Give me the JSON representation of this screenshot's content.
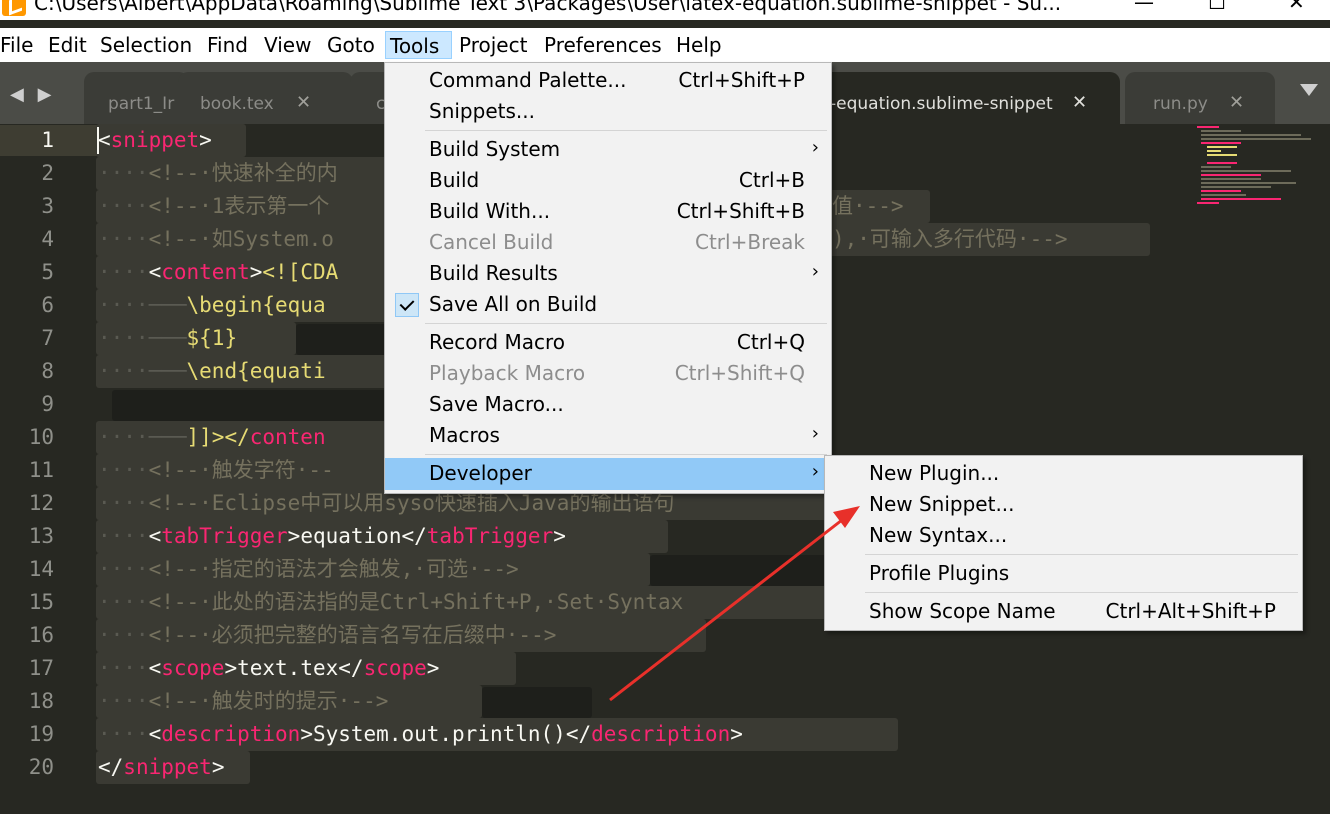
{
  "titlebar": {
    "title": "C:\\Users\\Albert\\AppData\\Roaming\\Sublime Text 3\\Packages\\User\\latex-equation.sublime-snippet - Su...",
    "minimize": "—",
    "maximize": "☐",
    "close": "✕"
  },
  "menubar": {
    "file": "File",
    "edit": "Edit",
    "selection": "Selection",
    "find": "Find",
    "view": "View",
    "goto": "Goto",
    "tools": "Tools",
    "project": "Project",
    "preferences": "Preferences",
    "help": "Help"
  },
  "tabs": {
    "nav_arrows": "◀ ▶",
    "t1": "part1_Ir",
    "t2": "book.tex",
    "t3": "c",
    "t4": "-equation.sublime-snippet",
    "t5": "run.py",
    "close": "✕"
  },
  "gutter": [
    "1",
    "2",
    "3",
    "4",
    "5",
    "6",
    "7",
    "8",
    "9",
    "10",
    "11",
    "12",
    "13",
    "14",
    "15",
    "16",
    "17",
    "18",
    "19",
    "20"
  ],
  "code": {
    "l1_tag": "snippet",
    "l2_cm": "<!--·快速补全的内",
    "l3_cm": "<!--·1表示第一个",
    "l3_tail": "值·-->",
    "l4_cm": "<!--·如System.o",
    "l4_tail": "),·可输入多行代码·-->",
    "l5_tag": "content",
    "l5_cdata": "<![CDA",
    "l6_str": "\\begin{equa",
    "l7_str": "${1}",
    "l8_str": "\\end{equati",
    "l10_end": "]]></",
    "l10_tag": "conten",
    "l11_cm": "<!--·触发字符·--",
    "l12_cm": "<!--·Eclipse中可以用syso快速插入Java的输出语句",
    "l13_tag": "tabTrigger",
    "l13_text": "equation",
    "l14_cm": "<!--·指定的语法才会触发,·可选·-->",
    "l15_cm": "<!--·此处的语法指的是Ctrl+Shift+P,·Set·Syntax",
    "l16_cm": "<!--·必须把完整的语言名写在后缀中·-->",
    "l17_tag": "scope",
    "l17_text": "text.tex",
    "l18_cm": "<!--·触发时的提示·-->",
    "l19_tag": "description",
    "l19_text": "System.out.println()",
    "l20_tag": "snippet"
  },
  "tools_menu": {
    "command_palette": "Command Palette...",
    "command_palette_key": "Ctrl+Shift+P",
    "snippets": "Snippets...",
    "build_system": "Build System",
    "build": "Build",
    "build_key": "Ctrl+B",
    "build_with": "Build With...",
    "build_with_key": "Ctrl+Shift+B",
    "cancel_build": "Cancel Build",
    "cancel_build_key": "Ctrl+Break",
    "build_results": "Build Results",
    "save_all_on_build": "Save All on Build",
    "record_macro": "Record Macro",
    "record_macro_key": "Ctrl+Q",
    "playback_macro": "Playback Macro",
    "playback_macro_key": "Ctrl+Shift+Q",
    "save_macro": "Save Macro...",
    "macros": "Macros",
    "developer": "Developer",
    "submenu_chevron": "›"
  },
  "developer_menu": {
    "new_plugin": "New Plugin...",
    "new_snippet": "New Snippet...",
    "new_syntax": "New Syntax...",
    "profile_plugins": "Profile Plugins",
    "show_scope_name": "Show Scope Name",
    "show_scope_name_key": "Ctrl+Alt+Shift+P"
  },
  "colors": {
    "editor_bg": "#272822",
    "tag": "#f92672",
    "comment": "#75715e",
    "string": "#e6db74",
    "menu_highlight": "#91c9f7",
    "annotation_arrow": "#e8302a"
  }
}
